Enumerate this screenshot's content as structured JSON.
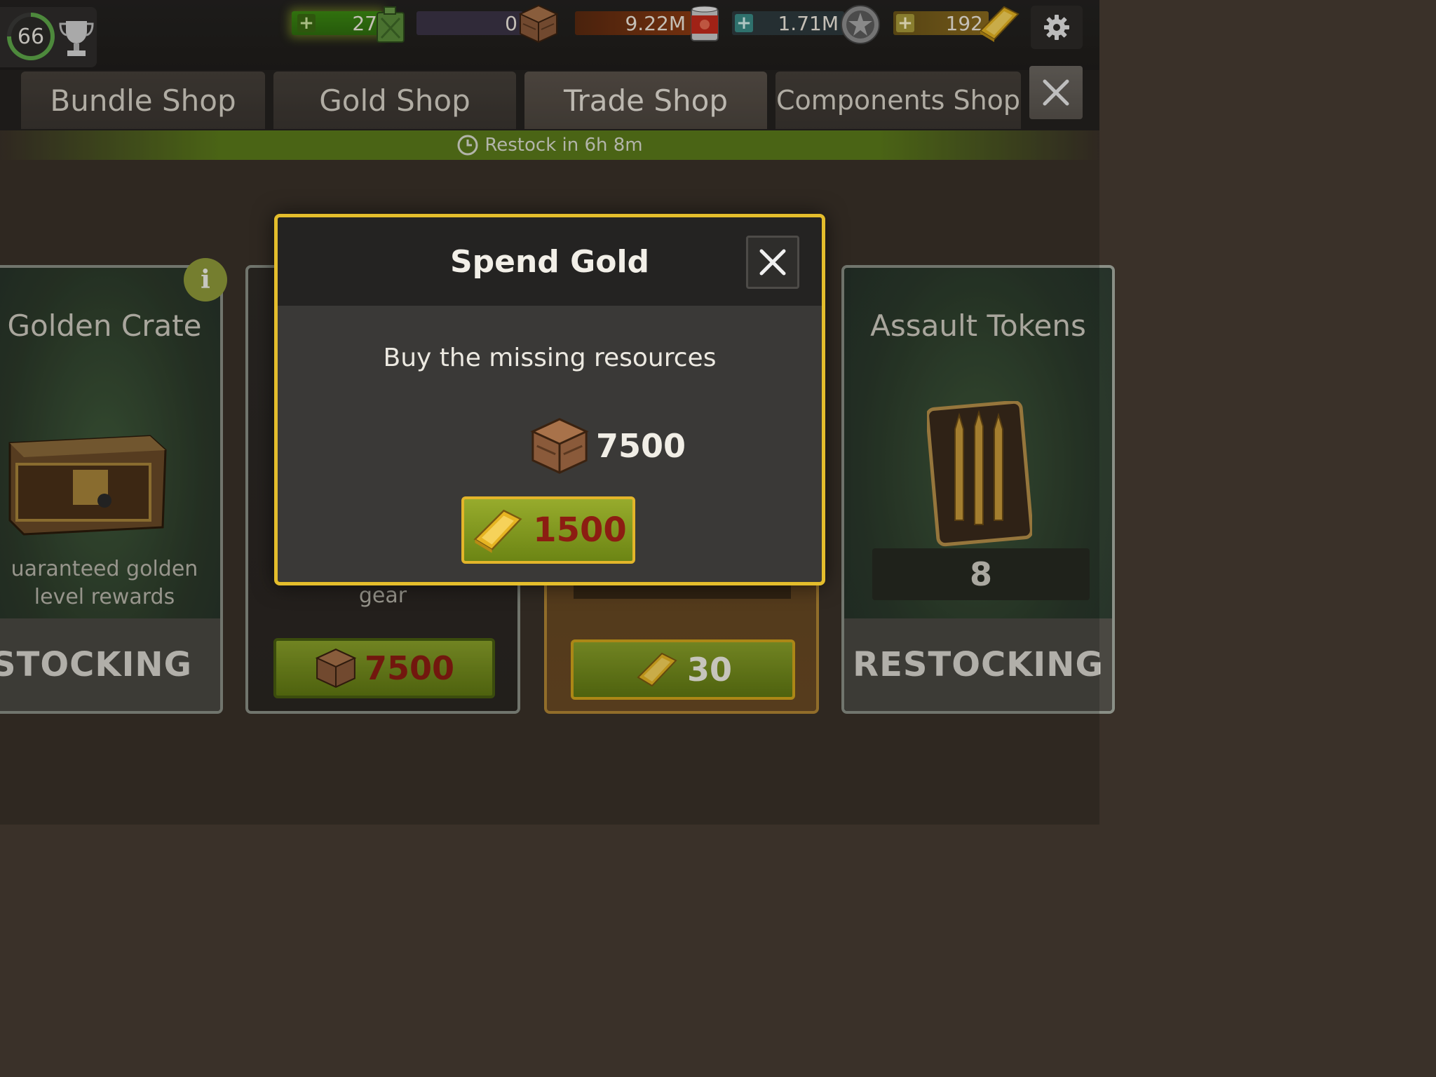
{
  "topbar": {
    "level": "66",
    "resources": [
      {
        "name": "fuel",
        "value": "27"
      },
      {
        "name": "supplies",
        "value": "0"
      },
      {
        "name": "food",
        "value": "9.22M"
      },
      {
        "name": "xp",
        "value": "1.71M"
      },
      {
        "name": "gold",
        "value": "192"
      }
    ]
  },
  "tabs": [
    {
      "label": "Bundle Shop"
    },
    {
      "label": "Gold Shop"
    },
    {
      "label": "Trade Shop"
    },
    {
      "label": "Components Shop"
    }
  ],
  "restock_banner": "Restock in 6h 8m",
  "cards": {
    "left": {
      "title": "Golden Crate",
      "desc_line1": "uaranteed golden",
      "desc_line2": "level rewards",
      "status": "RESTOCKING"
    },
    "mid": {
      "desc": "gear",
      "price": "7500"
    },
    "gold": {
      "price": "30"
    },
    "right": {
      "title": "Assault Tokens",
      "quantity": "8",
      "status": "RESTOCKING"
    }
  },
  "modal": {
    "title": "Spend Gold",
    "message": "Buy the missing resources",
    "resource_amount": "7500",
    "gold_cost": "1500"
  },
  "colors": {
    "accent_gold": "#e4bd2c",
    "button_green": "#7f9620",
    "price_red": "#8c1d12"
  }
}
